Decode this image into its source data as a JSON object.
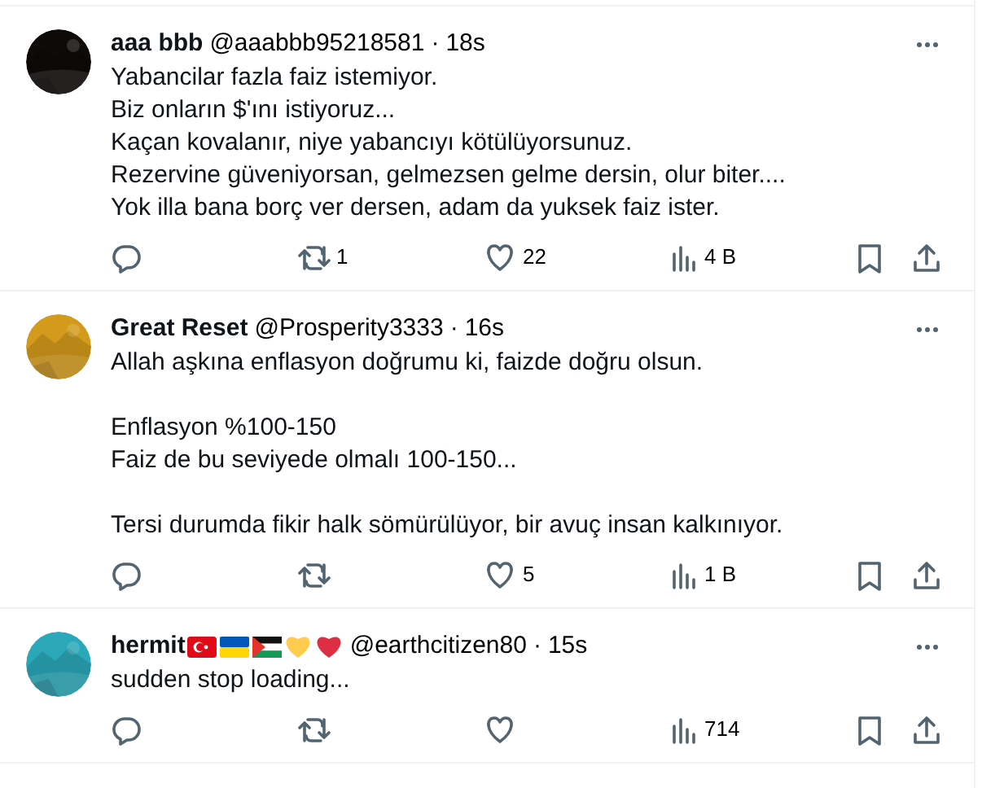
{
  "tweets": [
    {
      "avatar": {
        "kind": "picture",
        "color": "#0e0a08"
      },
      "name": "aaa bbb",
      "handle": "@aaabbb95218581",
      "separator": "·",
      "time": "18s",
      "paragraphs": [
        [
          "Yabancilar fazla faiz istemiyor.",
          "Biz onların $'ını istiyoruz...",
          "Kaçan kovalanır, niye yabancıyı kötülüyorsunuz.",
          "Rezervine güveniyorsan, gelmezsen gelme dersin, olur biter....",
          "Yok illa bana borç ver dersen, adam da yuksek faiz ister."
        ]
      ],
      "retweets": "1",
      "likes": "22",
      "views": "4 B"
    },
    {
      "avatar": {
        "kind": "picture",
        "color": "#d39a1c"
      },
      "name": "Great Reset",
      "handle": "@Prosperity3333",
      "separator": "·",
      "time": "16s",
      "paragraphs": [
        [
          "Allah aşkına enflasyon doğrumu ki, faizde doğru olsun."
        ],
        [
          "Enflasyon %100-150",
          "Faiz de bu seviyede olmalı 100-150..."
        ],
        [
          "Tersi durumda fikir halk sömürülüyor, bir avuç insan kalkınıyor."
        ]
      ],
      "likes": "5",
      "views": "1 B"
    },
    {
      "avatar": {
        "kind": "picture",
        "color": "#2aa7b8"
      },
      "name": "hermit",
      "name_icons": [
        {
          "kind": "turkey"
        },
        {
          "kind": "ukraine"
        },
        {
          "kind": "palestine"
        },
        {
          "kind": "heart",
          "color": "#ffcc4d"
        },
        {
          "kind": "heart",
          "color": "#dd2e44"
        }
      ],
      "handle": "@earthcitizen80",
      "separator": "·",
      "time": "15s",
      "paragraphs": [
        [
          "sudden stop loading..."
        ]
      ],
      "views": "714"
    }
  ]
}
